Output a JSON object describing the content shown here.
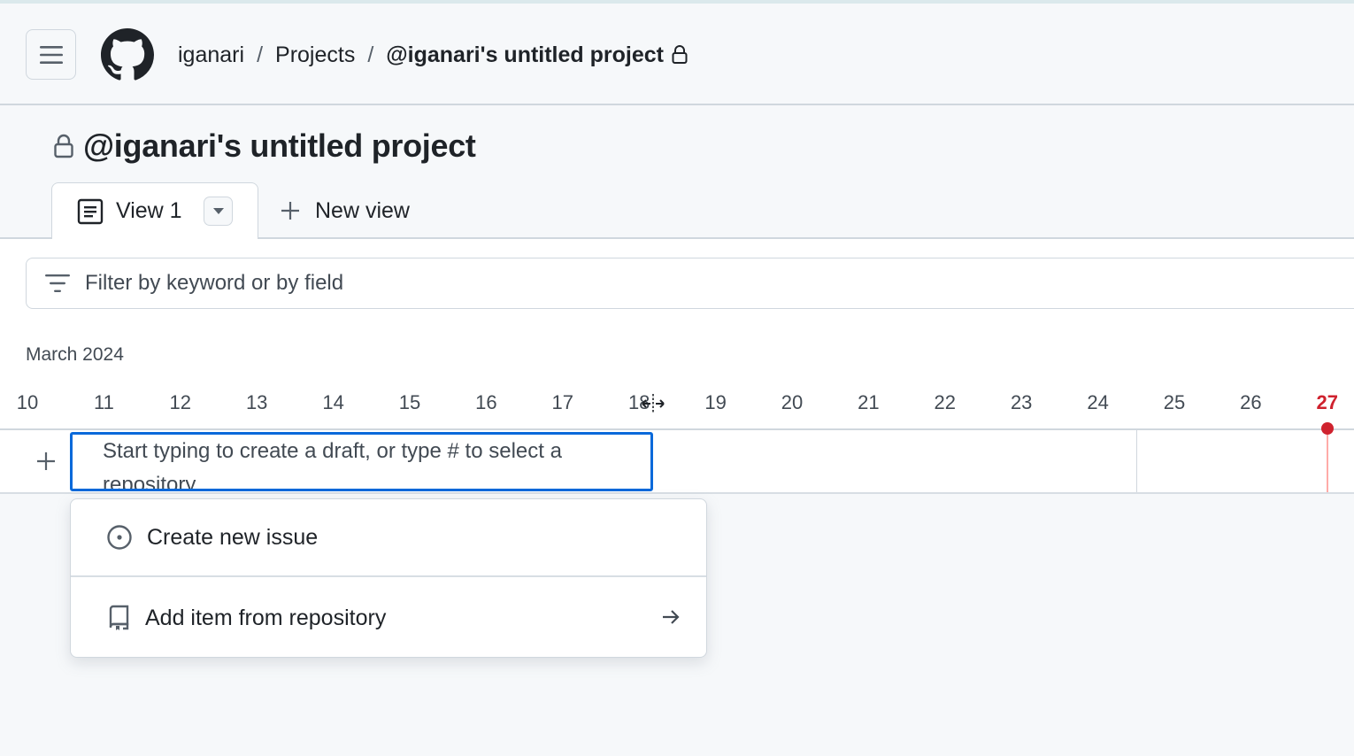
{
  "header": {
    "breadcrumb": {
      "owner": "iganari",
      "section": "Projects",
      "current": "@iganari's untitled project",
      "separator": "/"
    }
  },
  "project": {
    "title": "@iganari's untitled project"
  },
  "tabs": {
    "active_label": "View 1",
    "new_view_label": "New view"
  },
  "filter": {
    "placeholder": "Filter by keyword or by field"
  },
  "timeline": {
    "month": "March 2024",
    "days": [
      "10",
      "11",
      "12",
      "13",
      "14",
      "15",
      "16",
      "17",
      "18",
      "19",
      "20",
      "21",
      "22",
      "23",
      "24",
      "25",
      "26",
      "27"
    ],
    "today": "27"
  },
  "draft": {
    "placeholder": "Start typing to create a draft, or type # to select a repository"
  },
  "menu": {
    "items": [
      {
        "label": "Create new issue",
        "icon": "issue-opened-icon"
      },
      {
        "label": "Add item from repository",
        "icon": "repo-icon"
      }
    ]
  },
  "colors": {
    "accent": "#0969da",
    "today": "#cf222e",
    "border": "#d0d7de",
    "background": "#f6f8fa"
  }
}
